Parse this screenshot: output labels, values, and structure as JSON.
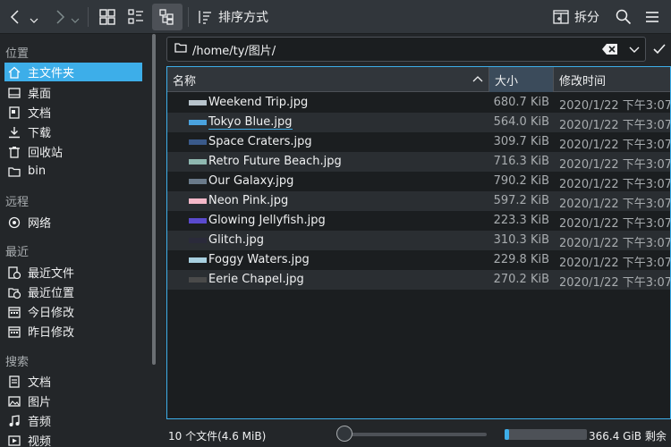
{
  "toolbar": {
    "sort_label": "排序方式",
    "split_label": "拆分"
  },
  "sidebar": {
    "sections": [
      {
        "title": "位置",
        "items": [
          {
            "label": "主文件夹",
            "icon": "home-icon",
            "selected": true
          },
          {
            "label": "桌面",
            "icon": "desktop-icon"
          },
          {
            "label": "文档",
            "icon": "documents-icon"
          },
          {
            "label": "下载",
            "icon": "download-icon"
          },
          {
            "label": "回收站",
            "icon": "trash-icon"
          },
          {
            "label": "bin",
            "icon": "folder-icon"
          }
        ]
      },
      {
        "title": "远程",
        "items": [
          {
            "label": "网络",
            "icon": "network-icon"
          }
        ]
      },
      {
        "title": "最近",
        "items": [
          {
            "label": "最近文件",
            "icon": "recent-files-icon"
          },
          {
            "label": "最近位置",
            "icon": "recent-locations-icon"
          },
          {
            "label": "今日修改",
            "icon": "calendar-icon"
          },
          {
            "label": "昨日修改",
            "icon": "calendar-icon"
          }
        ]
      },
      {
        "title": "搜索",
        "items": [
          {
            "label": "文档",
            "icon": "documents-icon"
          },
          {
            "label": "图片",
            "icon": "image-icon"
          },
          {
            "label": "音频",
            "icon": "audio-icon"
          },
          {
            "label": "视频",
            "icon": "video-icon"
          }
        ]
      }
    ]
  },
  "location": {
    "path": "/home/ty/图片/"
  },
  "columns": {
    "name": "名称",
    "size": "大小",
    "mtime": "修改时间"
  },
  "files": [
    {
      "name": "Weekend Trip.jpg",
      "size": "680.7 KiB",
      "mtime": "2020/1/22 下午3:07",
      "thumb": "#b8c4cc"
    },
    {
      "name": "Tokyo Blue.jpg",
      "size": "564.0 KiB",
      "mtime": "2020/1/22 下午3:07",
      "thumb": "#4aa3df"
    },
    {
      "name": "Space Craters.jpg",
      "size": "309.7 KiB",
      "mtime": "2020/1/22 下午3:07",
      "thumb": "#3a5a8a"
    },
    {
      "name": "Retro Future Beach.jpg",
      "size": "716.3 KiB",
      "mtime": "2020/1/22 下午3:07",
      "thumb": "#8fb8b0"
    },
    {
      "name": "Our Galaxy.jpg",
      "size": "790.2 KiB",
      "mtime": "2020/1/22 下午3:07",
      "thumb": "#6a7a8a"
    },
    {
      "name": "Neon Pink.jpg",
      "size": "597.2 KiB",
      "mtime": "2020/1/22 下午3:07",
      "thumb": "#f4b8c8"
    },
    {
      "name": "Glowing Jellyfish.jpg",
      "size": "223.3 KiB",
      "mtime": "2020/1/22 下午3:07",
      "thumb": "#5a4acd"
    },
    {
      "name": "Glitch.jpg",
      "size": "310.3 KiB",
      "mtime": "2020/1/22 下午3:07",
      "thumb": "#2a2a3a"
    },
    {
      "name": "Foggy Waters.jpg",
      "size": "229.8 KiB",
      "mtime": "2020/1/22 下午3:07",
      "thumb": "#a8d0e0"
    },
    {
      "name": "Eerie Chapel.jpg",
      "size": "270.2 KiB",
      "mtime": "2020/1/22 下午3:07",
      "thumb": "#4a4a4a"
    }
  ],
  "status": {
    "summary": "10 个文件(4.6 MiB)",
    "free_space": "366.4 GiB 剩余",
    "free_used_fraction": 0.05
  },
  "colors": {
    "accent": "#3daee9",
    "background": "#232629",
    "toolbar": "#31363b"
  }
}
